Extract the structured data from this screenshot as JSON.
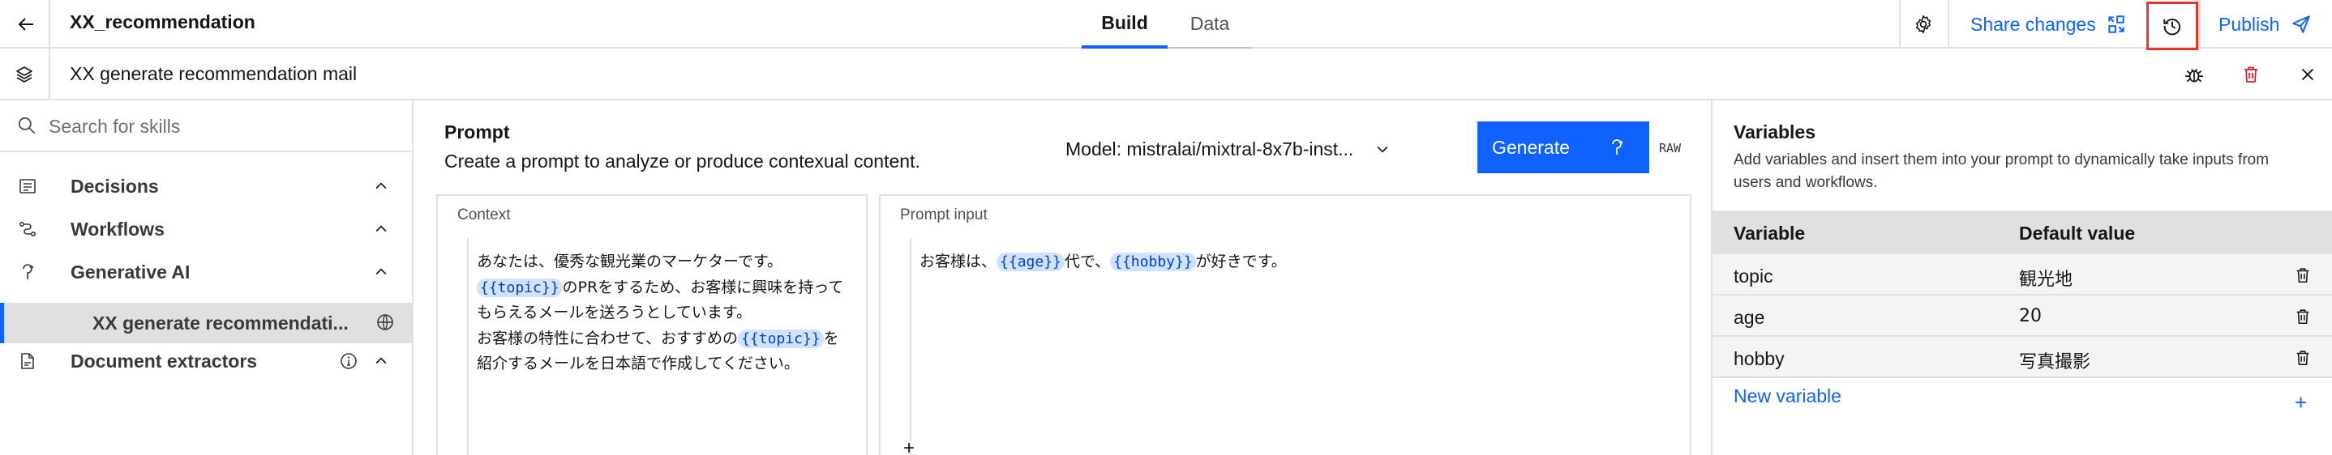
{
  "header": {
    "app_title": "XX_recommendation",
    "tabs": [
      "Build",
      "Data"
    ],
    "share_label": "Share changes",
    "publish_label": "Publish"
  },
  "subheader": {
    "skill_name": "XX generate recommendation mail"
  },
  "sidebar": {
    "search_placeholder": "Search for skills",
    "categories": [
      {
        "label": "Decisions",
        "icon": "decision-icon"
      },
      {
        "label": "Workflows",
        "icon": "workflow-icon"
      },
      {
        "label": "Generative AI",
        "icon": "generative-ai-icon"
      },
      {
        "label": "Document extractors",
        "icon": "document-extractor-icon"
      }
    ],
    "active_skill": "XX generate recommendati..."
  },
  "prompt": {
    "title": "Prompt",
    "description": "Create a prompt to analyze or produce contexual content.",
    "model_label": "Model: mistralai/mixtral-8x7b-inst...",
    "generate_label": "Generate",
    "raw_label": "RAW",
    "context_label": "Context",
    "input_label": "Prompt input",
    "context_lines": [
      {
        "pre": "あなたは、優秀な観光業のマーケターです。",
        "tok": "",
        "post": ""
      },
      {
        "pre": "",
        "tok": "{{topic}}",
        "post": "のPRをするため、お客様に興味を持って"
      },
      {
        "pre": "もらえるメールを送ろうとしています。",
        "tok": "",
        "post": ""
      },
      {
        "pre": "お客様の特性に合わせて、おすすめの",
        "tok": "{{topic}}",
        "post": "を"
      },
      {
        "pre": "紹介するメールを日本語で作成してください。",
        "tok": "",
        "post": ""
      }
    ],
    "input_segments": {
      "a": "お客様は、",
      "tok1": "{{age}}",
      "b": "代で、",
      "tok2": "{{hobby}}",
      "c": "が好きです。"
    },
    "add_symbol": "+"
  },
  "variables": {
    "title": "Variables",
    "description": "Add variables and insert them into your prompt to dynamically take inputs from users and workflows.",
    "col_variable": "Variable",
    "col_default": "Default value",
    "rows": [
      {
        "name": "topic",
        "value": "観光地"
      },
      {
        "name": "age",
        "value": "20"
      },
      {
        "name": "hobby",
        "value": "写真撮影"
      }
    ],
    "new_variable_label": "New variable",
    "new_variable_symbol": "+"
  },
  "colors": {
    "accent": "#0f62fe",
    "danger": "#da1e28",
    "highlight_border": "#e8352b",
    "token_bg": "#d0e2ff"
  }
}
